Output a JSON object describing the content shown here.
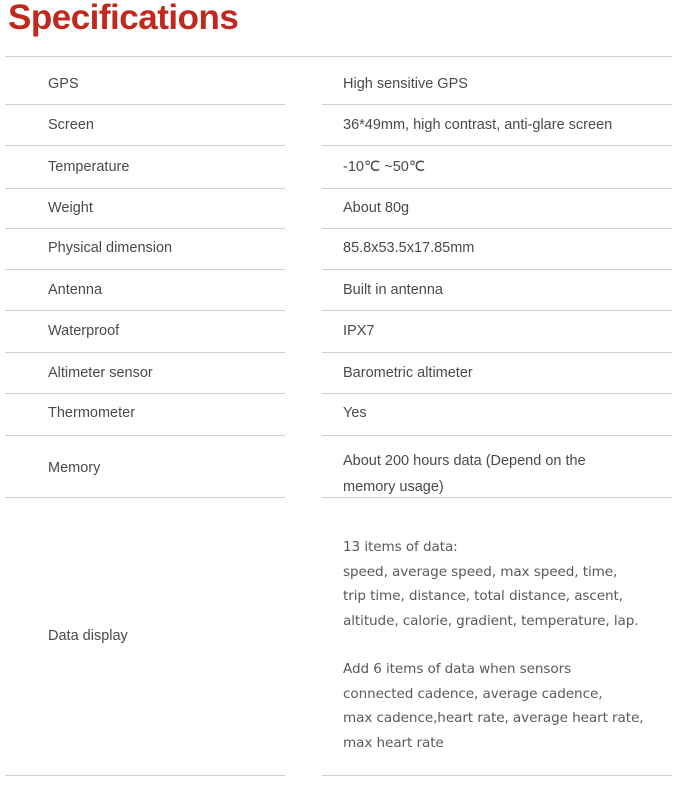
{
  "title": "Specifications",
  "colors": {
    "title": "#c1281e",
    "text": "#4a4a4a",
    "rule": "#cfcfcf",
    "background": "#ffffff"
  },
  "table": {
    "rows": [
      {
        "label": "GPS",
        "value": "High sensitive GPS"
      },
      {
        "label": "Screen",
        "value": "36*49mm, high contrast, anti-glare screen"
      },
      {
        "label": "Temperature",
        "value": "-10℃ ~50℃"
      },
      {
        "label": "Weight",
        "value": "About 80g"
      },
      {
        "label": "Physical dimension",
        "value": "85.8x53.5x17.85mm"
      },
      {
        "label": "Antenna",
        "value": "Built in antenna"
      },
      {
        "label": "Waterproof",
        "value": "IPX7"
      },
      {
        "label": "Altimeter sensor",
        "value": "Barometric altimeter"
      },
      {
        "label": "Thermometer",
        "value": "Yes"
      },
      {
        "label": "Memory",
        "value": "About 200 hours data (Depend on the memory  usage)"
      },
      {
        "label": "Data display",
        "value": ""
      }
    ],
    "data_display": {
      "label": "Data display",
      "paragraph_1": "13 items of data:\nspeed, average speed, max speed, time,\ntrip time, distance, total distance, ascent,\naltitude, calorie, gradient, temperature, lap.",
      "paragraph_2": "Add 6 items of data when sensors\nconnected cadence, average cadence,\nmax cadence,heart rate, average heart rate,\nmax heart rate"
    }
  }
}
